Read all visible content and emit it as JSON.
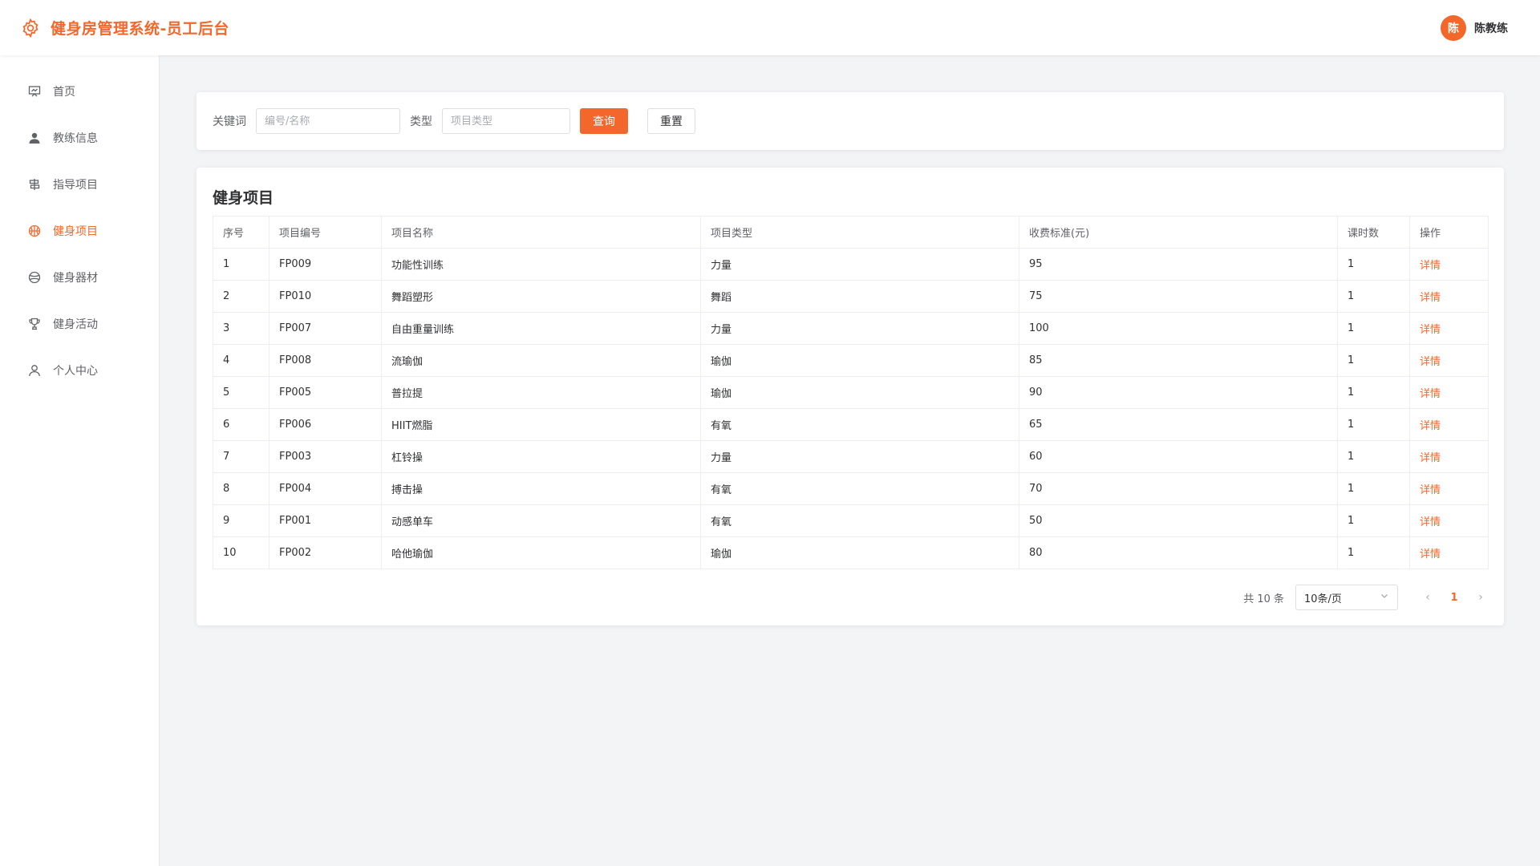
{
  "app": {
    "title": "健身房管理系统-员工后台"
  },
  "user": {
    "avatar_text": "陈",
    "name": "陈教练"
  },
  "sidebar": {
    "items": [
      {
        "label": "首页",
        "icon": "presentation-icon",
        "active": false
      },
      {
        "label": "教练信息",
        "icon": "user-solid-icon",
        "active": false
      },
      {
        "label": "指导项目",
        "icon": "guide-icon",
        "active": false
      },
      {
        "label": "健身项目",
        "icon": "basketball-icon",
        "active": true
      },
      {
        "label": "健身器材",
        "icon": "ball-icon",
        "active": false
      },
      {
        "label": "健身活动",
        "icon": "trophy-icon",
        "active": false
      },
      {
        "label": "个人中心",
        "icon": "user-outline-icon",
        "active": false
      }
    ]
  },
  "search": {
    "keyword_label": "关键词",
    "keyword_placeholder": "编号/名称",
    "keyword_value": "",
    "type_label": "类型",
    "type_placeholder": "项目类型",
    "type_value": "",
    "query_label": "查询",
    "reset_label": "重置"
  },
  "table": {
    "title": "健身项目",
    "columns": [
      "序号",
      "项目编号",
      "项目名称",
      "项目类型",
      "收费标准(元)",
      "课时数",
      "操作"
    ],
    "action_label": "详情",
    "rows": [
      [
        "1",
        "FP009",
        "功能性训练",
        "力量",
        "95",
        "1"
      ],
      [
        "2",
        "FP010",
        "舞蹈塑形",
        "舞蹈",
        "75",
        "1"
      ],
      [
        "3",
        "FP007",
        "自由重量训练",
        "力量",
        "100",
        "1"
      ],
      [
        "4",
        "FP008",
        "流瑜伽",
        "瑜伽",
        "85",
        "1"
      ],
      [
        "5",
        "FP005",
        "普拉提",
        "瑜伽",
        "90",
        "1"
      ],
      [
        "6",
        "FP006",
        "HIIT燃脂",
        "有氧",
        "65",
        "1"
      ],
      [
        "7",
        "FP003",
        "杠铃操",
        "力量",
        "60",
        "1"
      ],
      [
        "8",
        "FP004",
        "搏击操",
        "有氧",
        "70",
        "1"
      ],
      [
        "9",
        "FP001",
        "动感单车",
        "有氧",
        "50",
        "1"
      ],
      [
        "10",
        "FP002",
        "哈他瑜伽",
        "瑜伽",
        "80",
        "1"
      ]
    ]
  },
  "pagination": {
    "total_text": "共 10 条",
    "page_size": "10条/页",
    "current_page": "1"
  },
  "colors": {
    "accent": "#f4672a",
    "background": "#f3f4f6"
  }
}
